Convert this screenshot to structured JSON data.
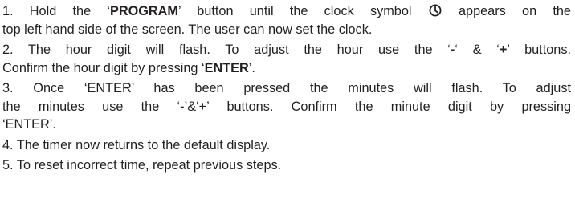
{
  "steps": [
    {
      "lines": [
        {
          "parts": [
            "1. Hold the ‘",
            "PROGRAM",
            "’ button until the clock symbol ",
            "",
            " appears on the"
          ]
        },
        {
          "text": "top left hand side of the screen.  The user can now set the clock."
        }
      ]
    },
    {
      "lines": [
        {
          "parts": [
            "2. The hour digit will flash. To adjust the hour use the ‘",
            "-",
            "‘ & ‘",
            "+",
            "’ buttons."
          ]
        },
        {
          "parts": [
            "Confirm the hour digit by pressing ‘",
            "ENTER",
            "’."
          ]
        }
      ]
    },
    {
      "lines": [
        {
          "text": "3. Once ‘ENTER’ has been pressed the minutes will flash.  To adjust"
        },
        {
          "text": "the minutes use the ‘-’&‘+’ buttons. Confirm the minute digit by pressing"
        },
        {
          "text": "‘ENTER’."
        }
      ]
    },
    {
      "lines": [
        {
          "text": "4. The timer now returns to the default display."
        }
      ]
    },
    {
      "lines": [
        {
          "text": "5. To reset incorrect time, repeat previous steps."
        }
      ]
    }
  ],
  "icons": {
    "clock": "clock-icon"
  }
}
